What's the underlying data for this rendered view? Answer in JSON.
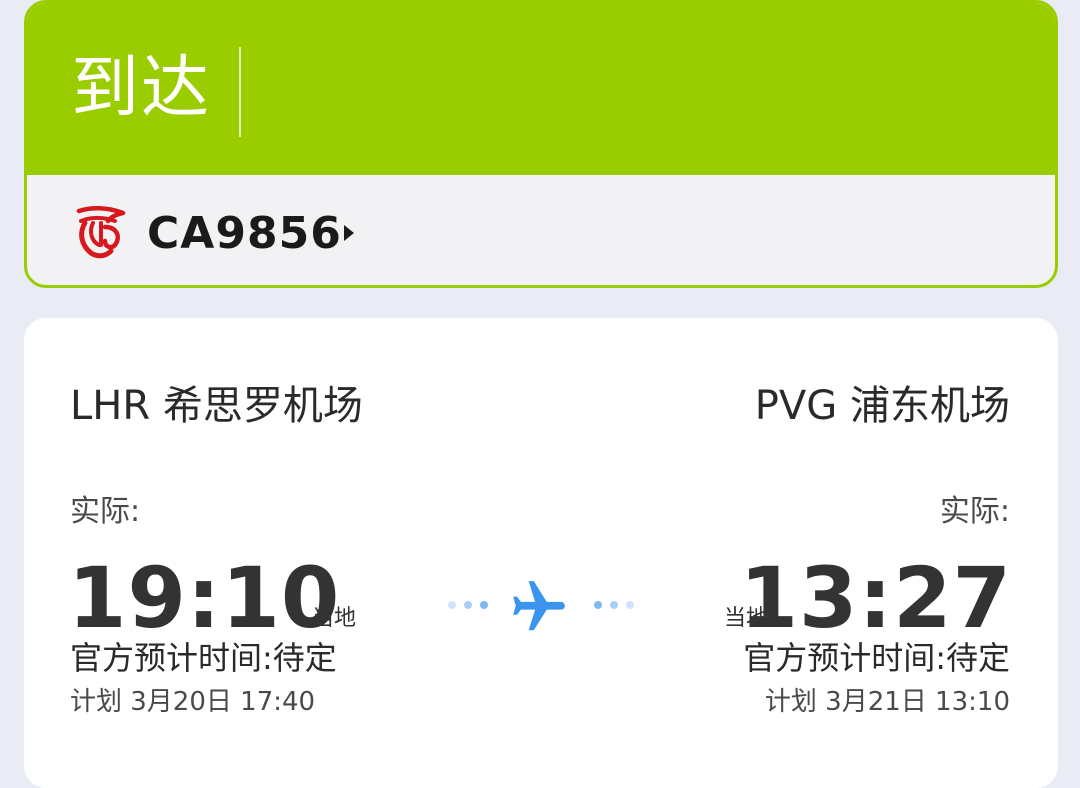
{
  "status": {
    "title": "到达",
    "band_color": "#9acd00"
  },
  "flight": {
    "number": "CA9856",
    "airline_logo_icon": "air-china-phoenix-logo-icon",
    "logo_color": "#d7191d"
  },
  "departure": {
    "airport": "LHR 希思罗机场",
    "actual_label": "实际:",
    "time": "19:10",
    "local_tag": "当地",
    "official_estimate": "官方预计时间:待定",
    "planned": "计划 3月20日 17:40"
  },
  "arrival": {
    "airport": "PVG 浦东机场",
    "actual_label": "实际:",
    "time": "13:27",
    "local_tag": "当地",
    "official_estimate": "官方预计时间:待定",
    "planned": "计划 3月21日 13:10"
  },
  "route_icon": {
    "name": "airplane-icon",
    "color": "#3b95f0"
  }
}
